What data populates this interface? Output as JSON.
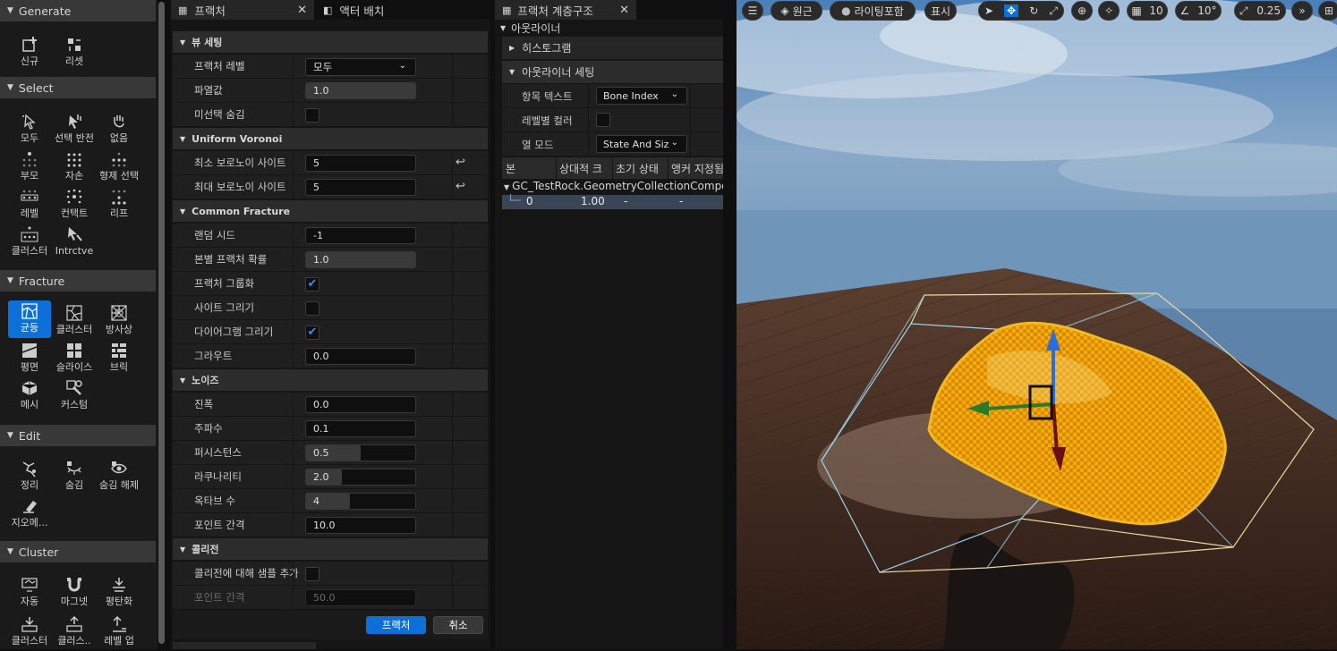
{
  "toolbar": {
    "sections": {
      "generate": "Generate",
      "select": "Select",
      "fracture": "Fracture",
      "edit": "Edit",
      "cluster": "Cluster"
    },
    "generate_tools": {
      "new": "신규",
      "reset": "리셋"
    },
    "select_tools": {
      "all": "모두",
      "invert": "선택 반전",
      "none": "없음",
      "parent": "부모",
      "children": "자손",
      "siblings": "형제 선택",
      "level": "레벨",
      "contact": "컨택트",
      "leaf": "리프",
      "cluster": "클러스터",
      "interactive": "Intrctve"
    },
    "fracture_tools": {
      "uniform": "균등",
      "clustered": "클러스터",
      "radial": "방사상",
      "planar": "평면",
      "slice": "슬라이스",
      "brick": "브릭",
      "mesh": "메시",
      "custom": "커스텀"
    },
    "edit_tools": {
      "prune": "정리",
      "hide": "숨김",
      "unhide": "숨김 해제",
      "geometry": "지오메..."
    },
    "cluster_tools": {
      "auto": "자동",
      "magnet": "마그넷",
      "flatten": "평탄화",
      "cluster": "클러스터",
      "cluster_up": "클러스..",
      "level_up": "레벨 업"
    },
    "accent": "#0d70d8"
  },
  "fracture_panel": {
    "tabs": {
      "fracture": "프랙처",
      "actor_placement": "액터 배치"
    },
    "view_settings": {
      "header": "뷰 세팅",
      "fracture_level_label": "프랙처 레벨",
      "fracture_level_value": "모두",
      "explode_label": "파열값",
      "explode_value": "1.0",
      "explode_fraction": 1.0,
      "hide_unselected_label": "미선택 숨김",
      "hide_unselected": false
    },
    "voronoi": {
      "header": "Uniform Voronoi",
      "min_sites_label": "최소 보로노이 사이트",
      "min_sites_value": "5",
      "max_sites_label": "최대 보로노이 사이트",
      "max_sites_value": "5"
    },
    "common": {
      "header": "Common Fracture",
      "seed_label": "랜덤 시드",
      "seed_value": "-1",
      "chance_label": "본별 프랙처 확률",
      "chance_value": "1.0",
      "chance_fraction": 1.0,
      "group_label": "프랙처 그룹화",
      "group_checked": true,
      "draw_sites_label": "사이트 그리기",
      "draw_sites_checked": false,
      "draw_diagram_label": "다이어그램 그리기",
      "draw_diagram_checked": true,
      "grout_label": "그라우트",
      "grout_value": "0.0"
    },
    "noise": {
      "header": "노이즈",
      "amplitude_label": "진폭",
      "amplitude_value": "0.0",
      "frequency_label": "주파수",
      "frequency_value": "0.1",
      "persistence_label": "퍼시스턴스",
      "persistence_value": "0.5",
      "persistence_fraction": 0.5,
      "lacunarity_label": "라쿠나리티",
      "lacunarity_value": "2.0",
      "lacunarity_fraction": 0.33,
      "octaves_label": "옥타브 수",
      "octaves_value": "4",
      "octaves_fraction": 0.4,
      "point_spacing_label": "포인트 간격",
      "point_spacing_value": "10.0"
    },
    "collision": {
      "header": "콜리전",
      "add_samples_label": "콜리전에 대해 샘플 추가",
      "add_samples_checked": false,
      "point_spacing_label": "포인트 간격",
      "point_spacing_value": "50.0"
    },
    "buttons": {
      "fracture": "프랙처",
      "cancel": "취소"
    }
  },
  "hierarchy": {
    "tab": "프랙처 계층구조",
    "outliner_header": "아웃라이너",
    "histogram": "히스토그램",
    "outliner_settings": "아웃라이너 세팅",
    "item_text_label": "항목 텍스트",
    "item_text_value": "Bone Index",
    "color_by_level_label": "레벨별 컬러",
    "color_by_level": false,
    "column_mode_label": "열 모드",
    "column_mode_value": "State And Siz",
    "columns": [
      "본",
      "상대적 크",
      "초기 상태",
      "앵커 지정됨"
    ],
    "root_item": "GC_TestRock.GeometryCollectionCompo",
    "rows": [
      {
        "bone": "0",
        "relative_size": "1.00",
        "initial_state": "-",
        "anchored": "-"
      }
    ]
  },
  "viewport": {
    "perspective": "원근",
    "lighting": "라이팅포함",
    "show": "표시",
    "grid_snap": "10",
    "rotation_snap": "10°",
    "scale_snap": "0.25",
    "icons": [
      "menu-icon",
      "select-tool-icon",
      "translate-tool-icon",
      "rotate-tool-icon",
      "scale-tool-icon",
      "world-space-icon",
      "surface-snap-icon",
      "grid-snap-icon",
      "rotation-snap-icon",
      "scale-snap-icon",
      "expand-icon",
      "layout-icon"
    ]
  }
}
